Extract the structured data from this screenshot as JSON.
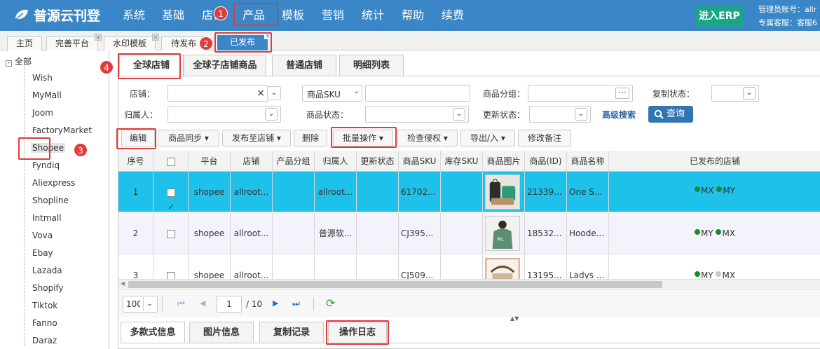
{
  "app": {
    "name": "普源云刊登"
  },
  "topnav": [
    {
      "label": "系统"
    },
    {
      "label": "基础"
    },
    {
      "label": "店铺"
    },
    {
      "label": "产品"
    },
    {
      "label": "模板"
    },
    {
      "label": "营销"
    },
    {
      "label": "统计"
    },
    {
      "label": "帮助"
    },
    {
      "label": "续费"
    }
  ],
  "erp_button": "进入ERP",
  "account": {
    "line1": "管理员账号：allr",
    "line2": "专属客服：客服6"
  },
  "page_tabs": [
    {
      "label": "主页"
    },
    {
      "label": "完善平台"
    },
    {
      "label": "水印模板"
    },
    {
      "label": "待发布"
    },
    {
      "label": "已发布"
    }
  ],
  "tree": {
    "root": "全部",
    "items": [
      "Wish",
      "MyMall",
      "Joom",
      "FactoryMarket",
      "Shopee",
      "Fyndiq",
      "Aliexpress",
      "Shopline",
      "Intmall",
      "Vova",
      "Ebay",
      "Lazada",
      "Shopify",
      "Tiktok",
      "Fanno",
      "Daraz"
    ]
  },
  "sub_tabs": [
    "全球店铺",
    "全球子店铺商品",
    "普通店铺",
    "明细列表"
  ],
  "filters": {
    "shop": "店铺：",
    "sku_select": "商品SKU",
    "group": "商品分组：",
    "copy_status": "复制状态：",
    "owner": "归属人：",
    "product_status": "商品状态：",
    "update_status": "更新状态：",
    "advanced": "高级搜索",
    "search": "查询",
    "clear": "×",
    "ellipsis": "···"
  },
  "toolbar": {
    "edit": "编辑",
    "sync": "商品同步",
    "publish_to": "发布至店铺",
    "delete": "删除",
    "batch": "批量操作",
    "check": "检查侵权",
    "export": "导出/入",
    "remark": "修改备注"
  },
  "table": {
    "headers": [
      "序号",
      "",
      "平台",
      "店铺",
      "产品分组",
      "归属人",
      "更新状态",
      "商品SKU",
      "库存SKU",
      "商品图片",
      "商品(ID)",
      "商品名称",
      "已发布的店铺"
    ],
    "rows": [
      {
        "no": "1",
        "platform": "shopee",
        "shop": "allroot...",
        "owner": "allroot...",
        "sku": "61702...",
        "id": "21339...",
        "name": "One S...",
        "stores": [
          "MX",
          "MY"
        ],
        "checked": true
      },
      {
        "no": "2",
        "platform": "shopee",
        "shop": "allroot...",
        "owner": "普源软...",
        "sku": "CJ395...",
        "id": "18532...",
        "name": "Hoode...",
        "stores": [
          "MY",
          "MX"
        ],
        "checked": false
      },
      {
        "no": "3",
        "platform": "shopee",
        "shop": "allroot...",
        "owner": "",
        "sku": "CJ509...",
        "id": "13195...",
        "name": "Ladys ...",
        "stores": [
          "MY",
          "MX"
        ],
        "checked": false
      }
    ]
  },
  "pager": {
    "page_size": "100",
    "current": "1",
    "total": "/ 10"
  },
  "bottom_tabs": [
    "多款式信息",
    "图片信息",
    "复制记录",
    "操作日志"
  ],
  "markers": [
    "1",
    "2",
    "3",
    "4"
  ],
  "colors": {
    "header": "#3b86c7",
    "erp": "#1aa589",
    "selected_row": "#1ec1ea",
    "highlight": "#e23b3b"
  }
}
